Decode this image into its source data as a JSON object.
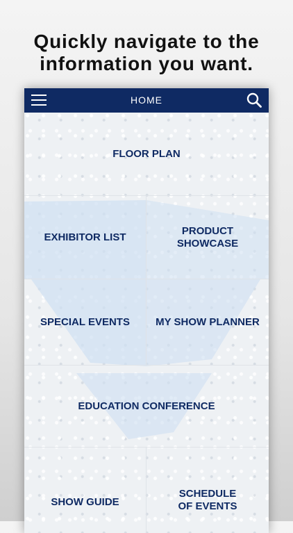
{
  "promo": {
    "line1": "Quickly navigate to the",
    "line2": "information you want."
  },
  "navbar": {
    "title": "HOME",
    "menu_icon": "hamburger-menu-icon",
    "search_icon": "search-icon"
  },
  "tiles": {
    "floor_plan": "FLOOR PLAN",
    "exhibitor_list": "EXHIBITOR LIST",
    "product_showcase": "PRODUCT\nSHOWCASE",
    "special_events": "SPECIAL EVENTS",
    "my_show_planner": "MY SHOW PLANNER",
    "education_conference": "EDUCATION CONFERENCE",
    "show_guide": "SHOW GUIDE",
    "schedule_of_events": "SCHEDULE\nOF EVENTS"
  },
  "colors": {
    "navbar": "#0f2a63",
    "tile_text": "#0f2a63",
    "watermark": "#cfe0f2"
  }
}
